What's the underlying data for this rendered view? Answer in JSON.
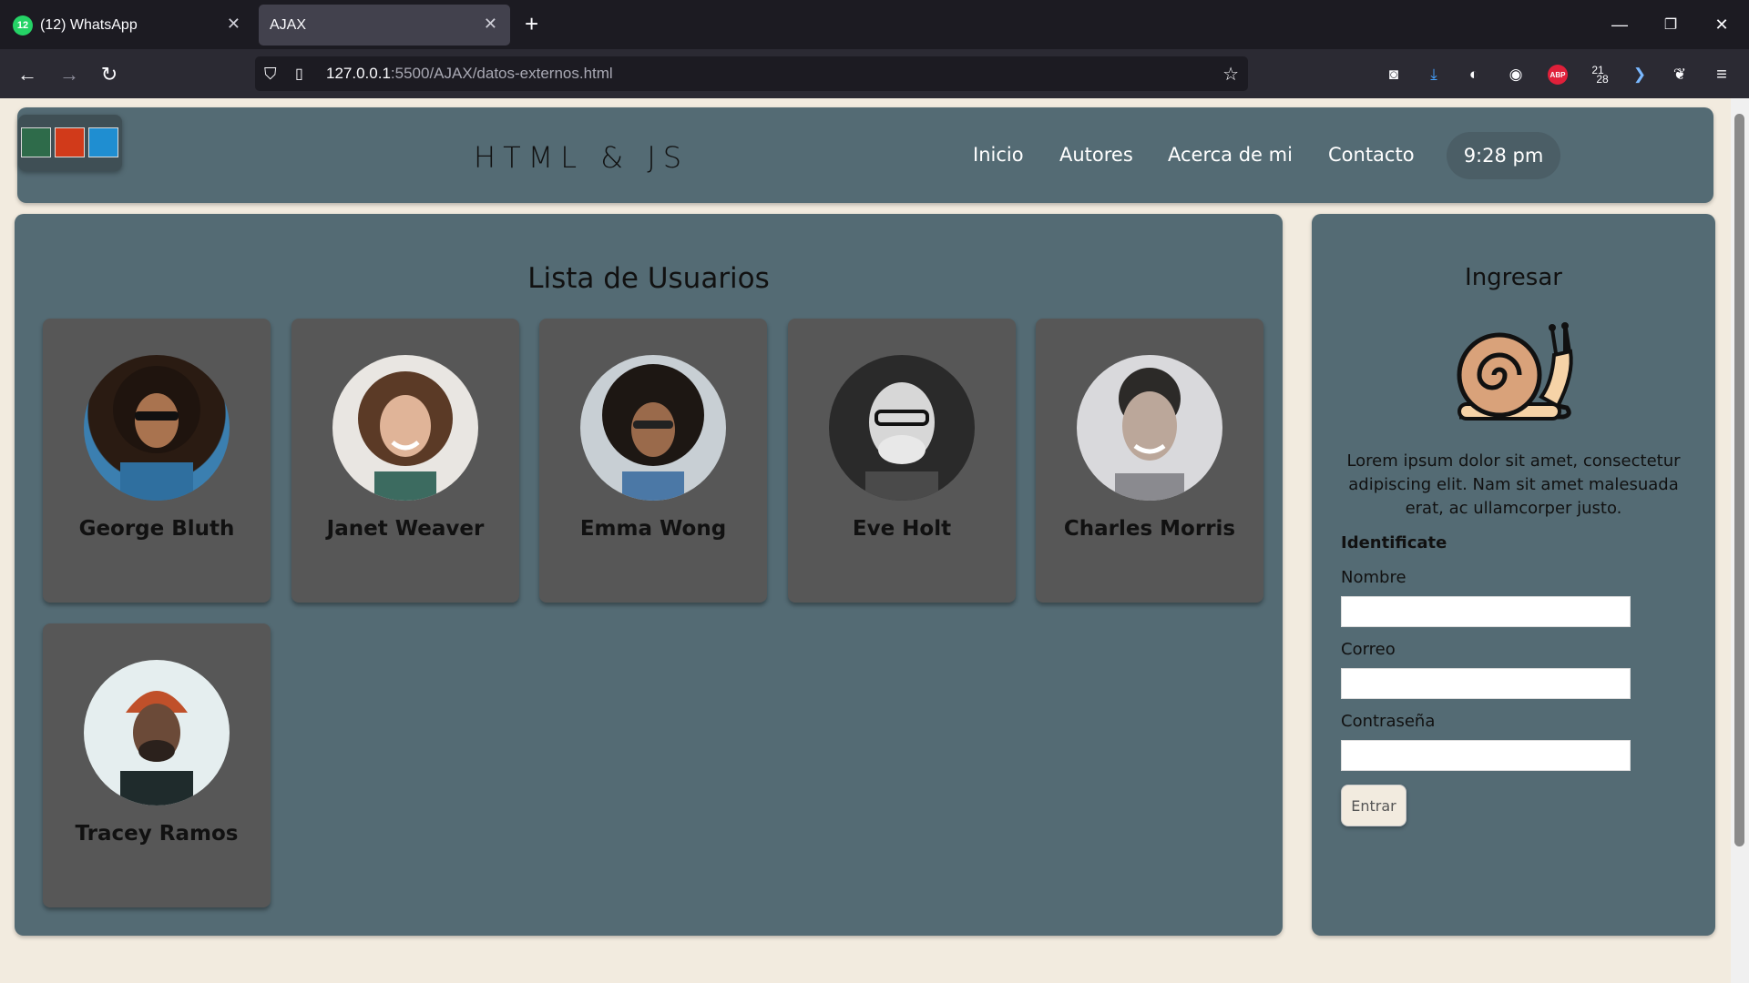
{
  "browser": {
    "tabs": [
      {
        "label": "(12) WhatsApp",
        "badge": "12"
      },
      {
        "label": "AJAX"
      }
    ],
    "url_host": "127.0.0.1",
    "url_rest": ":5500/AJAX/datos-externos.html",
    "toolbar_badge": "21",
    "toolbar_badge_sub": "28",
    "abp_label": "ABP"
  },
  "header": {
    "brand": "HTML & JS",
    "nav": [
      "Inicio",
      "Autores",
      "Acerca de mi",
      "Contacto"
    ],
    "clock": "9:28 pm",
    "swatch_colors": [
      "#2e6b4a",
      "#d13a1a",
      "#1f8ed1"
    ]
  },
  "users": {
    "title": "Lista de Usuarios",
    "items": [
      {
        "name": "George Bluth"
      },
      {
        "name": "Janet Weaver"
      },
      {
        "name": "Emma Wong"
      },
      {
        "name": "Eve Holt"
      },
      {
        "name": "Charles Morris"
      },
      {
        "name": "Tracey Ramos"
      }
    ]
  },
  "login": {
    "title": "Ingresar",
    "description": "Lorem ipsum dolor sit amet, consectetur adipiscing elit. Nam sit amet malesuada erat, ac ullamcorper justo.",
    "form_title": "Identificate",
    "labels": {
      "name": "Nombre",
      "email": "Correo",
      "password": "Contraseña"
    },
    "submit": "Entrar"
  },
  "colors": {
    "panel": "#546b74",
    "card": "#575757",
    "page_bg": "#f2ebdf"
  }
}
